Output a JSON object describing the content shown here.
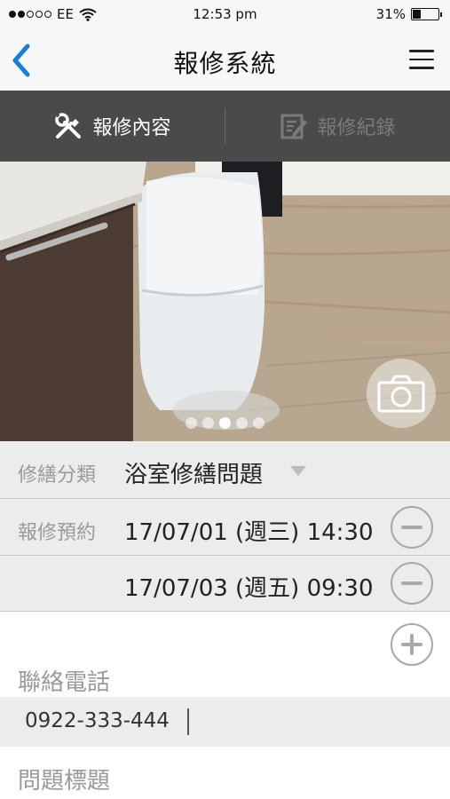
{
  "status_bar": {
    "carrier": "EE",
    "time": "12:53 pm",
    "battery_percent": "31%",
    "battery_level": 0.31,
    "signal_bars_filled": 2,
    "signal_bars_total": 5,
    "icons": [
      "signal-dots-icon",
      "wifi-icon",
      "battery-icon"
    ]
  },
  "nav": {
    "title": "報修系統",
    "back_icon": "chevron-left-icon",
    "menu_icon": "hamburger-menu-icon"
  },
  "tabs": [
    {
      "label": "報修內容",
      "icon": "tools-icon",
      "active": true
    },
    {
      "label": "報修紀錄",
      "icon": "edit-note-icon",
      "active": false
    }
  ],
  "photo": {
    "camera_icon": "camera-icon",
    "page_count": 5,
    "active_page": 3
  },
  "form": {
    "category": {
      "label": "修繕分類",
      "value": "浴室修繕問題"
    },
    "appointment": {
      "label": "報修預約",
      "slots": [
        "17/07/01 (週三) 14:30",
        "17/07/03 (週五) 09:30"
      ]
    },
    "phone": {
      "label": "聯絡電話",
      "value": "0922-333-444"
    },
    "title_field": {
      "label": "問題標題"
    }
  },
  "colors": {
    "accent": "#1a7ed6",
    "tab_bar": "#4a4a4a",
    "row_bg": "#ececec"
  }
}
